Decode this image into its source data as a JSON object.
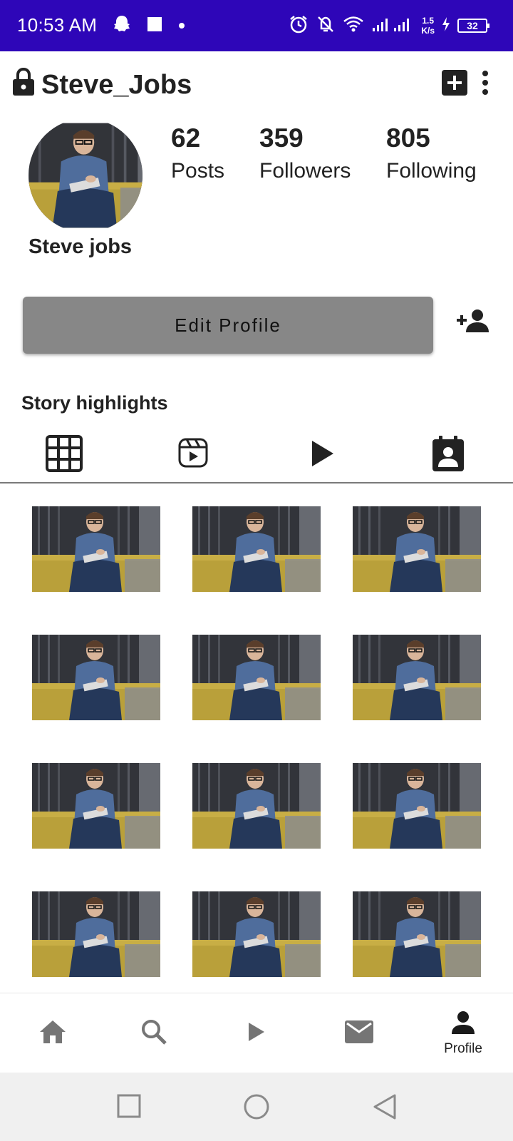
{
  "status_bar": {
    "time": "10:53 AM",
    "speed_value": "1.5",
    "speed_unit": "K/s",
    "battery": "32",
    "icons": [
      "snapchat-icon",
      "square-icon",
      "dot-icon",
      "alarm-icon",
      "bell-off-icon",
      "wifi-icon",
      "signal-icon",
      "charging-icon",
      "battery-icon"
    ],
    "background": "#2e06b8"
  },
  "header": {
    "username": "Steve_Jobs",
    "icons": [
      "lock-icon",
      "add-post-icon",
      "more-vert-icon"
    ]
  },
  "profile": {
    "display_name": "Steve jobs",
    "stats": [
      {
        "value": "62",
        "label": "Posts"
      },
      {
        "value": "359",
        "label": "Followers"
      },
      {
        "value": "805",
        "label": "Following"
      }
    ]
  },
  "actions": {
    "edit_profile_label": "Edit Profile",
    "edit_profile_color": "#878787"
  },
  "story_highlights": {
    "title": "Story highlights"
  },
  "tabs": [
    {
      "icon": "grid-icon",
      "selected": true
    },
    {
      "icon": "reels-icon",
      "selected": false
    },
    {
      "icon": "play-icon",
      "selected": false
    },
    {
      "icon": "tagged-icon",
      "selected": false
    }
  ],
  "posts": {
    "count": 12,
    "columns": 3
  },
  "bottom_nav": {
    "items": [
      {
        "icon": "home-icon",
        "label": ""
      },
      {
        "icon": "search-icon",
        "label": ""
      },
      {
        "icon": "play-icon",
        "label": ""
      },
      {
        "icon": "mail-icon",
        "label": ""
      },
      {
        "icon": "profile-icon",
        "label": "Profile"
      }
    ]
  },
  "system_nav": {
    "icons": [
      "recents-icon",
      "home-circle-icon",
      "back-icon"
    ]
  }
}
